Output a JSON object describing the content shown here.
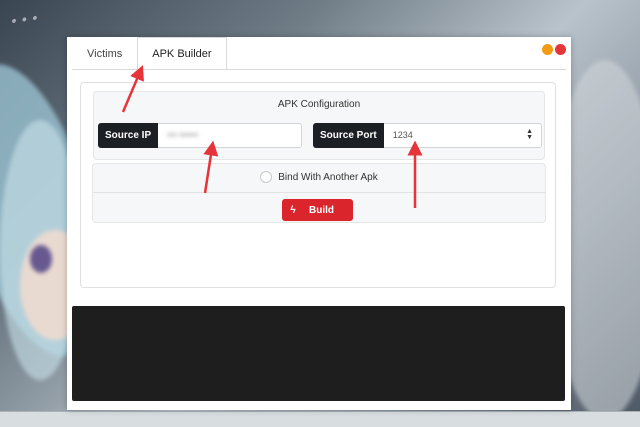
{
  "background": {
    "text": "..."
  },
  "window": {
    "tabs": [
      {
        "label": "Victims",
        "active": false
      },
      {
        "label": "APK Builder",
        "active": true
      }
    ],
    "controls": {
      "minimize_color": "#f39c12",
      "close_color": "#e5343a"
    }
  },
  "apk_config": {
    "title": "APK Configuration",
    "source_ip": {
      "label": "Source IP",
      "value": "•••  ••••••"
    },
    "source_port": {
      "label": "Source Port",
      "value": "1234"
    },
    "bind_label": "Bind With Another Apk",
    "bind_checked": false,
    "build_label": "Build",
    "build_icon": "bolt-icon",
    "build_color": "#d9252b"
  },
  "console": {
    "text": ""
  },
  "annotations": {
    "arrow_color": "#e5343a"
  }
}
